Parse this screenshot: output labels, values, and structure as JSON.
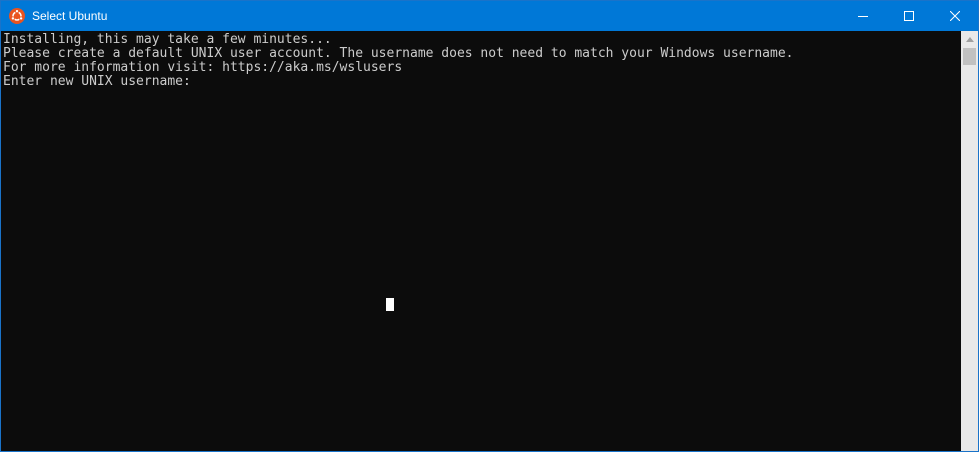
{
  "window": {
    "title": "Select Ubuntu",
    "icon": "ubuntu-logo-icon",
    "accent_color": "#0078d7"
  },
  "controls": {
    "minimize_icon": "minimize-icon",
    "maximize_icon": "maximize-icon",
    "close_icon": "close-icon"
  },
  "console": {
    "background": "#0c0c0c",
    "text_color": "#cccccc",
    "lines": [
      "Installing, this may take a few minutes...",
      "Please create a default UNIX user account. The username does not need to match your Windows username.",
      "For more information visit: https://aka.ms/wslusers",
      "Enter new UNIX username:"
    ]
  },
  "scrollbar": {
    "up_icon": "chevron-up-icon"
  }
}
